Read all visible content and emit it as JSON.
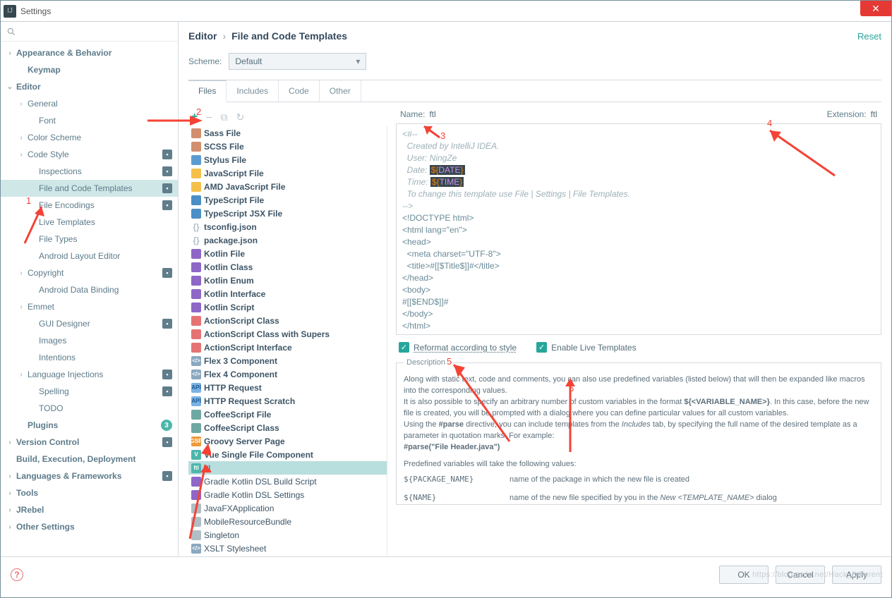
{
  "window": {
    "title": "Settings"
  },
  "breadcrumb": {
    "a": "Editor",
    "b": "File and Code Templates"
  },
  "reset": "Reset",
  "scheme": {
    "label": "Scheme:",
    "value": "Default"
  },
  "tabs": [
    "Files",
    "Includes",
    "Code",
    "Other"
  ],
  "sidebar": {
    "items": [
      {
        "l": "Appearance & Behavior",
        "d": 1,
        "c": 1,
        "b": 1
      },
      {
        "l": "Keymap",
        "d": 2,
        "b": 1
      },
      {
        "l": "Editor",
        "d": 1,
        "c": 2,
        "b": 1
      },
      {
        "l": "General",
        "d": 2,
        "c": 1
      },
      {
        "l": "Font",
        "d": 3
      },
      {
        "l": "Color Scheme",
        "d": 2,
        "c": 1
      },
      {
        "l": "Code Style",
        "d": 2,
        "c": 1,
        "bg": 1
      },
      {
        "l": "Inspections",
        "d": 3,
        "bg": 1
      },
      {
        "l": "File and Code Templates",
        "d": 3,
        "sel": 1,
        "bg": 1
      },
      {
        "l": "File Encodings",
        "d": 3,
        "bg": 1
      },
      {
        "l": "Live Templates",
        "d": 3
      },
      {
        "l": "File Types",
        "d": 3
      },
      {
        "l": "Android Layout Editor",
        "d": 3
      },
      {
        "l": "Copyright",
        "d": 2,
        "c": 1,
        "bg": 1
      },
      {
        "l": "Android Data Binding",
        "d": 3
      },
      {
        "l": "Emmet",
        "d": 2,
        "c": 1
      },
      {
        "l": "GUI Designer",
        "d": 3,
        "bg": 1
      },
      {
        "l": "Images",
        "d": 3
      },
      {
        "l": "Intentions",
        "d": 3
      },
      {
        "l": "Language Injections",
        "d": 2,
        "c": 1,
        "bg": 1
      },
      {
        "l": "Spelling",
        "d": 3,
        "bg": 1
      },
      {
        "l": "TODO",
        "d": 3
      },
      {
        "l": "Plugins",
        "d": 2,
        "b": 1,
        "dot": "3"
      },
      {
        "l": "Version Control",
        "d": 1,
        "c": 1,
        "b": 1,
        "bg": 1
      },
      {
        "l": "Build, Execution, Deployment",
        "d": 1,
        "b": 1
      },
      {
        "l": "Languages & Frameworks",
        "d": 1,
        "c": 1,
        "b": 1,
        "bg": 1
      },
      {
        "l": "Tools",
        "d": 1,
        "c": 1,
        "b": 1
      },
      {
        "l": "JRebel",
        "d": 1,
        "c": 1,
        "b": 1
      },
      {
        "l": "Other Settings",
        "d": 1,
        "c": 1,
        "b": 1
      }
    ]
  },
  "templates": [
    {
      "l": "Sass File",
      "c": "c-sass",
      "b": 1
    },
    {
      "l": "SCSS File",
      "c": "c-sass",
      "b": 1
    },
    {
      "l": "Stylus File",
      "c": "c-blue",
      "b": 1
    },
    {
      "l": "JavaScript File",
      "c": "c-js",
      "b": 1
    },
    {
      "l": "AMD JavaScript File",
      "c": "c-js",
      "b": 1
    },
    {
      "l": "TypeScript File",
      "c": "c-ts",
      "b": 1
    },
    {
      "l": "TypeScript JSX File",
      "c": "c-ts",
      "b": 1
    },
    {
      "l": "tsconfig.json",
      "c": "c-json",
      "b": 1,
      "t": "{}"
    },
    {
      "l": "package.json",
      "c": "c-json",
      "b": 1,
      "t": "{}"
    },
    {
      "l": "Kotlin File",
      "c": "c-kt",
      "b": 1
    },
    {
      "l": "Kotlin Class",
      "c": "c-kt",
      "b": 1
    },
    {
      "l": "Kotlin Enum",
      "c": "c-kt",
      "b": 1
    },
    {
      "l": "Kotlin Interface",
      "c": "c-kt",
      "b": 1
    },
    {
      "l": "Kotlin Script",
      "c": "c-kt",
      "b": 1
    },
    {
      "l": "ActionScript Class",
      "c": "c-as",
      "b": 1
    },
    {
      "l": "ActionScript Class with Supers",
      "c": "c-as",
      "b": 1
    },
    {
      "l": "ActionScript Interface",
      "c": "c-as",
      "b": 1
    },
    {
      "l": "Flex 3 Component",
      "c": "c-xml",
      "b": 1,
      "t": "</>"
    },
    {
      "l": "Flex 4 Component",
      "c": "c-xml",
      "b": 1,
      "t": "</>"
    },
    {
      "l": "HTTP Request",
      "c": "c-http",
      "b": 1,
      "t": "API"
    },
    {
      "l": "HTTP Request Scratch",
      "c": "c-http",
      "b": 1,
      "t": "API"
    },
    {
      "l": "CoffeeScript File",
      "c": "c-cs",
      "b": 1
    },
    {
      "l": "CoffeeScript Class",
      "c": "c-cs",
      "b": 1
    },
    {
      "l": "Groovy Server Page",
      "c": "c-gsp",
      "b": 1,
      "t": "GSP"
    },
    {
      "l": "Vue Single File Component",
      "c": "c-vue",
      "b": 1,
      "t": "V"
    },
    {
      "l": "ftl",
      "c": "c-ftl",
      "sel": 1,
      "t": "ftl"
    },
    {
      "l": "Gradle Kotlin DSL Build Script",
      "c": "c-kt"
    },
    {
      "l": "Gradle Kotlin DSL Settings",
      "c": "c-kt"
    },
    {
      "l": "JavaFXApplication",
      "c": "c-grey"
    },
    {
      "l": "MobileResourceBundle",
      "c": "c-grey"
    },
    {
      "l": "Singleton",
      "c": "c-grey"
    },
    {
      "l": "XSLT Stylesheet",
      "c": "c-xml",
      "t": "</>"
    }
  ],
  "fields": {
    "nameLabel": "Name:",
    "nameVal": "ftl",
    "extLabel": "Extension:",
    "extVal": "ftl"
  },
  "editor": {
    "l1": "<#--",
    "l2": "  Created by IntelliJ IDEA.",
    "l3": "  User: NingZe",
    "l4a": "  Date: ",
    "l4b": "${",
    "l4c": "DATE",
    "l4d": "}",
    "l5a": "  Time: ",
    "l5b": "${",
    "l5c": "TIME",
    "l5d": "}",
    "l6": "  To change this template use File | Settings | File Templates.",
    "l7": "-->",
    "l8": "<!DOCTYPE html>",
    "l9": "<html lang=\"en\">",
    "l10": "<head>",
    "l11": "  <meta charset=\"UTF-8\">",
    "l12": "  <title>#[[$Title$]]#</title>",
    "l13": "</head>",
    "l14": "<body>",
    "l15": "#[[$END$]]#",
    "l16": "</body>",
    "l17": "</html>"
  },
  "checks": {
    "a": "Reformat according to style",
    "b": "Enable Live Templates"
  },
  "desc": {
    "title": "Description",
    "p1": "Along with static text, code and comments, you can also use predefined variables (listed below) that will then be expanded like macros into the corresponding values.",
    "p2a": "It is also possible to specify an arbitrary number of custom variables in the format ",
    "p2b": "${<VARIABLE_NAME>}",
    "p2c": ". In this case, before the new file is created, you will be prompted with a dialog where you can define particular values for all custom variables.",
    "p3a": "Using the ",
    "p3b": "#parse",
    "p3c": " directive, you can include templates from the ",
    "p3d": "Includes",
    "p3e": " tab, by specifying the full name of the desired template as a parameter in quotation marks. For example:",
    "p4": "#parse(\"File Header.java\")",
    "p5": "Predefined variables will take the following values:",
    "v1k": "${PACKAGE_NAME}",
    "v1v": "name of the package in which the new file is created",
    "v2k": "${NAME}",
    "v2va": "name of the new file specified by you in the ",
    "v2vb": "New <TEMPLATE_NAME>",
    "v2vc": " dialog"
  },
  "buttons": {
    "ok": "OK",
    "cancel": "Cancel",
    "apply": "Apply"
  },
  "watermark": "https://blog.csdn.net/Hack_Different",
  "ann": {
    "n1": "1",
    "n2": "2",
    "n3": "3",
    "n4": "4",
    "n5": "5",
    "n6": "6"
  }
}
